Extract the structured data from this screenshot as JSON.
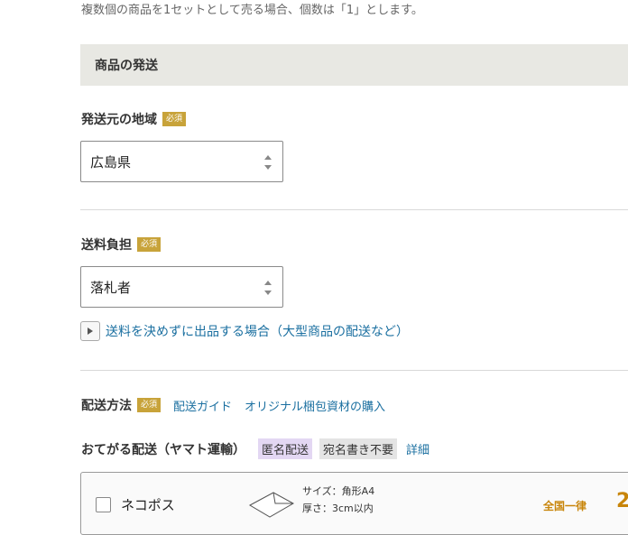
{
  "top_note": "複数個の商品を1セットとして売る場合、個数は「1」とします。",
  "section": {
    "title": "商品の発送"
  },
  "required_label": "必須",
  "origin": {
    "label": "発送元の地域",
    "selected": "広島県"
  },
  "shipping_fee": {
    "label": "送料負担",
    "selected": "落札者",
    "toggle_link": "送料を決めずに出品する場合（大型商品の配送など）"
  },
  "method": {
    "label": "配送方法",
    "links": {
      "guide": "配送ガイド",
      "packaging": "オリジナル梱包資材の購入"
    }
  },
  "carrier": {
    "title": "おてがる配送（ヤマト運輸）",
    "tag_anonymous": "匿名配送",
    "tag_no_address": "宛名書き不要",
    "detail_link": "詳細"
  },
  "option": {
    "name": "ネコポス",
    "size": "サイズ：角形A4",
    "thickness": "厚さ：3cm以内",
    "price_label": "全国一律",
    "price_partial": "2"
  },
  "colors": {
    "required_badge": "#c8a33a",
    "link": "#1a6fa0",
    "section_bg": "#e8e8e3",
    "price": "#c8850a",
    "anonymous_tag": "#e3d7f3"
  },
  "icons": [
    "select-arrows-icon",
    "caret-right-icon",
    "envelope-icon"
  ]
}
